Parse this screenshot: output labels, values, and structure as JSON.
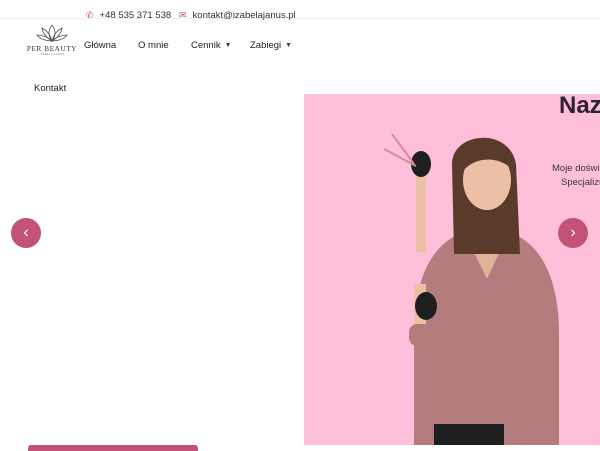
{
  "topbar": {
    "phone": "+48 535 371 538",
    "email": "kontakt@izabelajanus.pl",
    "phone_icon": "phone-icon",
    "email_icon": "envelope-icon"
  },
  "logo": {
    "brand": "PER BEAUTY",
    "tagline": "IZABELA JANUS"
  },
  "nav": {
    "items": [
      "Główna",
      "O mnie",
      "Cennik",
      "Zabiegi",
      "Kontakt"
    ],
    "caret_icon": "chevron-down-icon"
  },
  "hero": {
    "title": "Naz",
    "line1": "Moje doświ",
    "line2": "Specjalizu"
  },
  "slider": {
    "prev_icon": "chevron-left-icon",
    "next_icon": "chevron-right-icon",
    "prev_glyph": "‹",
    "next_glyph": "›"
  },
  "colors": {
    "accent": "#c25277",
    "hero_bg": "#fdbfda",
    "icon": "#c2506f"
  }
}
